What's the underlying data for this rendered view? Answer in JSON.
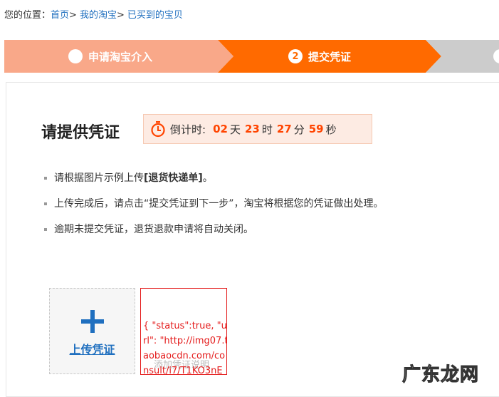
{
  "breadcrumb": {
    "prefix": "您的位置：",
    "items": [
      "首页",
      "我的淘宝",
      "已买到的宝贝"
    ],
    "separator": ">"
  },
  "steps": [
    {
      "label": "申请淘宝介入",
      "status": "done",
      "icon": "check-icon"
    },
    {
      "label": "提交凭证",
      "status": "active",
      "number": "2"
    },
    {
      "label": "",
      "status": "pending"
    }
  ],
  "colors": {
    "step_done": "#f9a889",
    "step_active": "#ff6a00",
    "step_pending": "#cccccc",
    "countdown_number": "#ff4400",
    "link": "#1f6fbf",
    "example_border": "#e41b1b"
  },
  "main": {
    "title": "请提供凭证",
    "countdown": {
      "label": "倒计时:",
      "days": "02",
      "days_unit": "天",
      "hours": "23",
      "hours_unit": "时",
      "minutes": "27",
      "minutes_unit": "分",
      "seconds": "59",
      "seconds_unit": "秒"
    },
    "rules": [
      {
        "text": "请根据图片示例上传",
        "highlight": "[退货快递单]",
        "suffix": "。"
      },
      {
        "text": "上传完成后，请点击“提交凭证到下一步”，淘宝将根据您的凭证做出处理。"
      },
      {
        "text": "逾期未提交凭证，退货退款申请将自动关闭。"
      }
    ],
    "upload_label": "上传凭证",
    "example_caption": "添加凭证说明",
    "example_text": "{ \"status\":true, \"u\nrl\": \"http://img07.t\naobaocdn.com/co\nnsult/i7/T1KO3nE"
  },
  "watermark": "广东龙网"
}
